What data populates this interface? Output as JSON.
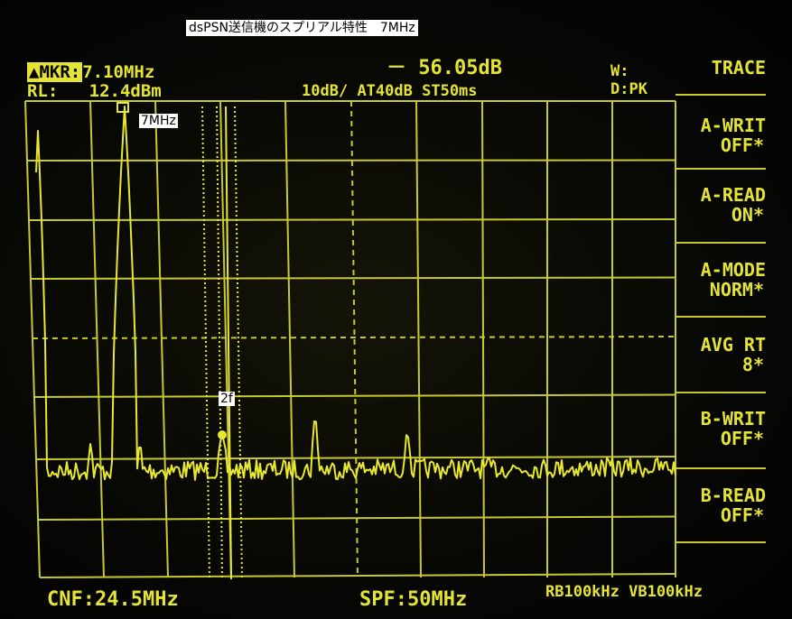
{
  "caption": "dsPSN送信機のスプリアル特性　7MHz",
  "header": {
    "marker_tag": "▲MKR:",
    "marker_freq": "7.10MHz",
    "marker_level": "－ 56.05dB",
    "ref_label": "RL:",
    "ref_level": "12.4dBm",
    "scale": "10dB/",
    "attenuation": "AT40dB",
    "sweep_time": "ST50ms",
    "window_label": "W:",
    "detector": "D:PK"
  },
  "softkeys": {
    "title": "TRACE",
    "items": [
      {
        "line1": "A-WRIT",
        "line2": "OFF*"
      },
      {
        "line1": "A-READ",
        "line2": "ON*"
      },
      {
        "line1": "A-MODE",
        "line2": "NORM*"
      },
      {
        "line1": "AVG RT",
        "line2": "8*"
      },
      {
        "line1": "B-WRIT",
        "line2": "OFF*"
      },
      {
        "line1": "B-READ",
        "line2": "OFF*"
      }
    ]
  },
  "annotations": {
    "fundamental": "7MHz",
    "second_harmonic": "2f"
  },
  "footer": {
    "center_freq": "CNF:24.5MHz",
    "span": "SPF:50MHz",
    "rbw_vbw": "RB100kHz VB100kHz"
  },
  "colors": {
    "trace": "#e8e832",
    "grid": "#c8c830",
    "background": "#050505",
    "label_box": "#ffffff"
  }
}
